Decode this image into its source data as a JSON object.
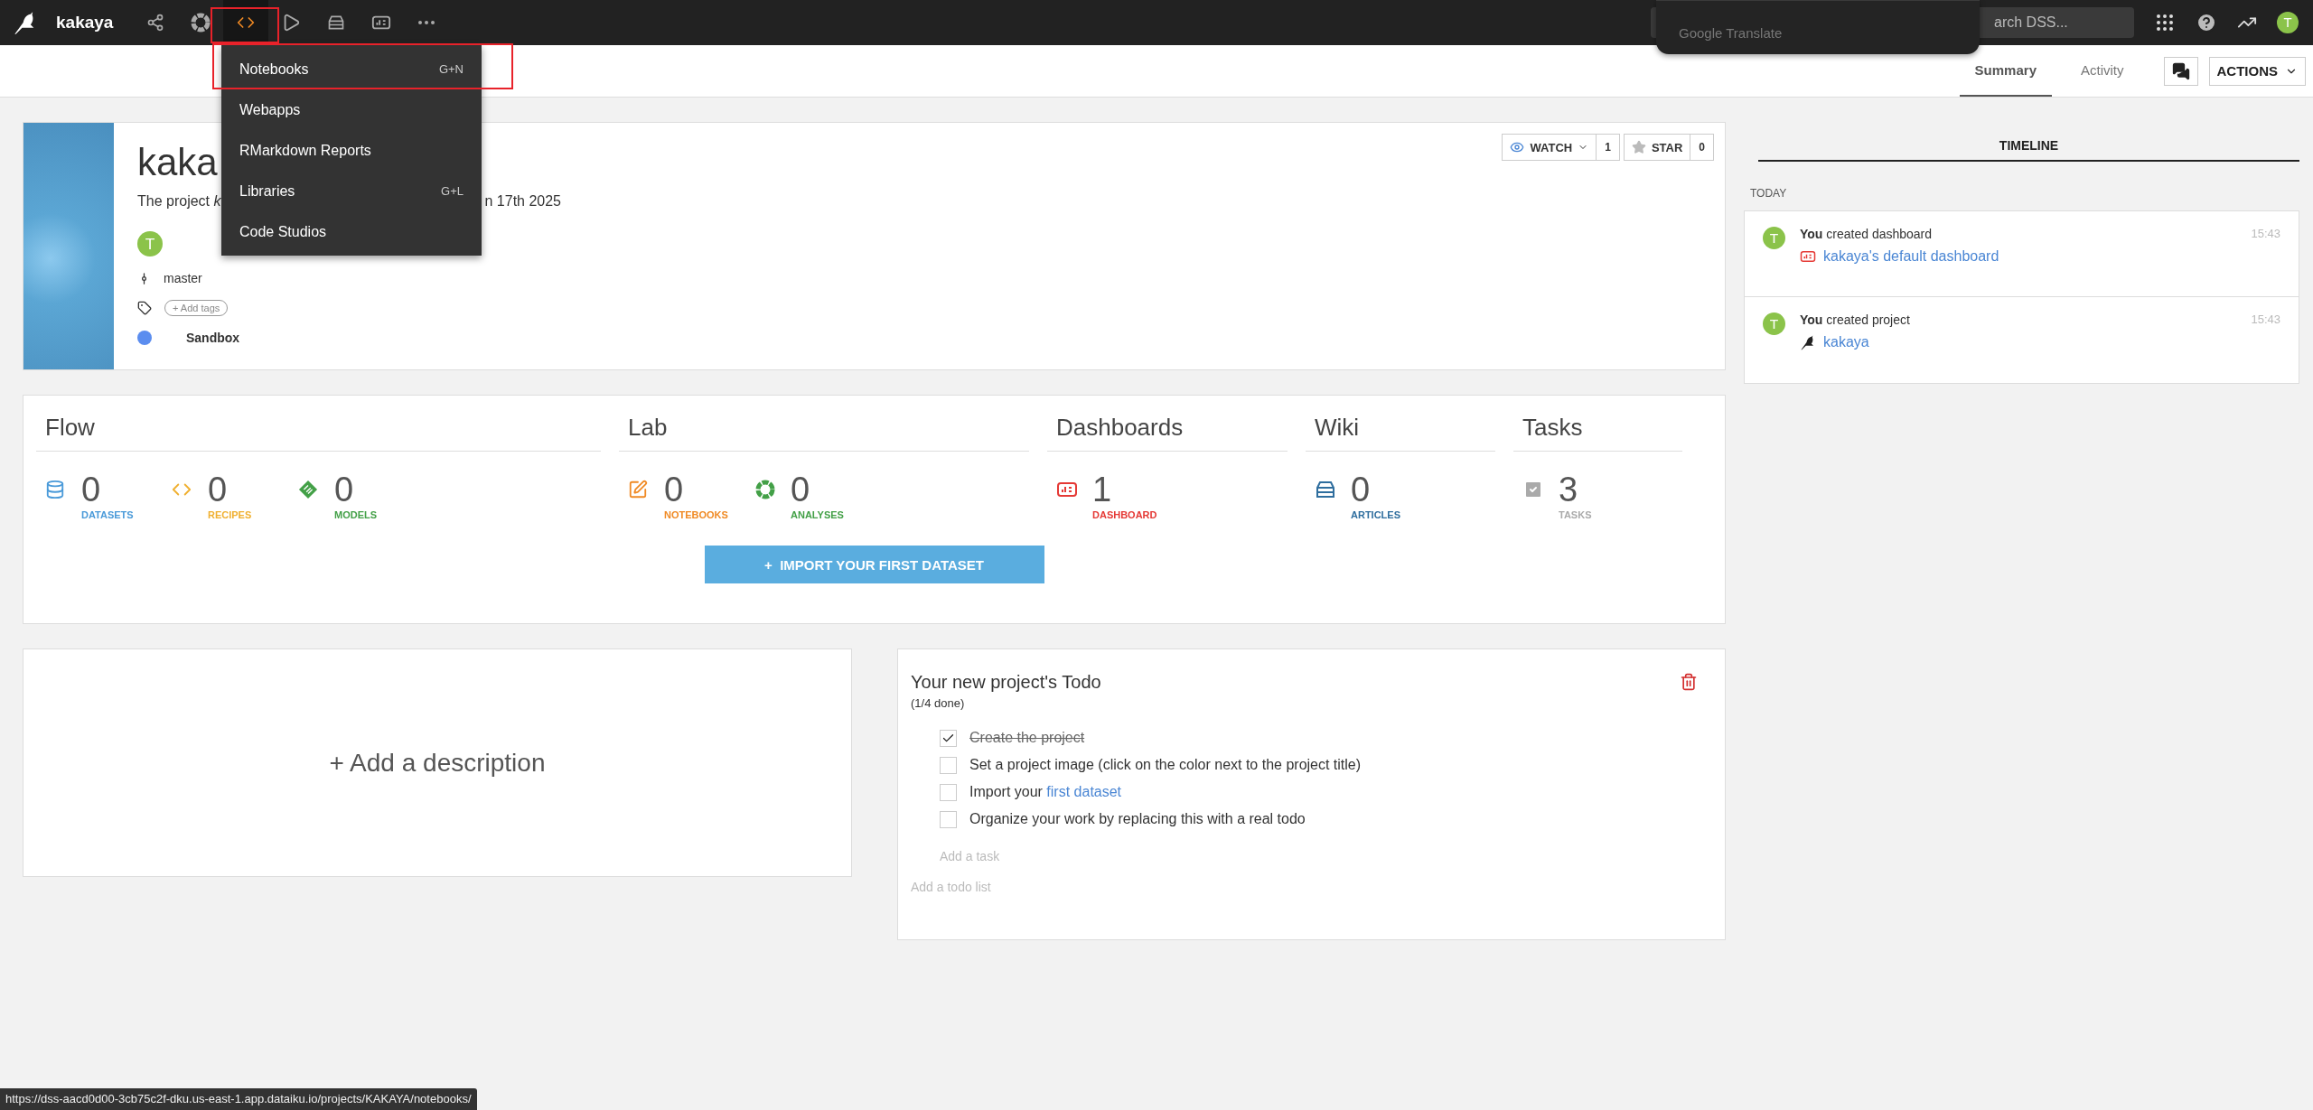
{
  "top_bar": {
    "project_name": "kakaya",
    "nav_items": [
      {
        "kind": "flow",
        "selected": false
      },
      {
        "kind": "analyses",
        "selected": false
      },
      {
        "kind": "code",
        "selected": true
      },
      {
        "kind": "run",
        "selected": false
      },
      {
        "kind": "wiki",
        "selected": false
      },
      {
        "kind": "dashboard",
        "selected": false
      },
      {
        "kind": "more",
        "selected": false
      }
    ],
    "search": {
      "placeholder": "arch DSS..."
    },
    "user_avatar": "T"
  },
  "translate_popup": {
    "label": "Google Translate"
  },
  "code_menu": {
    "items": [
      {
        "label": "Notebooks",
        "shortcut": "G+N"
      },
      {
        "label": "Webapps"
      },
      {
        "label": "RMarkdown Reports"
      },
      {
        "label": "Libraries",
        "shortcut": "G+L"
      },
      {
        "label": "Code Studios"
      }
    ]
  },
  "sub_bar": {
    "tabs": [
      {
        "label": "Summary",
        "selected": true
      },
      {
        "label": "Activity",
        "selected": false
      }
    ],
    "actions_button": "ACTIONS"
  },
  "project": {
    "title": "kaka",
    "description_start": "The project *k*",
    "description_end": "n 17th 2025",
    "owner_initial": "T",
    "branch": "master",
    "add_tags": "+ Add tags",
    "status": {
      "label": "Sandbox",
      "color": "#5b8def"
    },
    "watch": {
      "label": "WATCH",
      "count": "1"
    },
    "star": {
      "label": "STAR",
      "count": "0"
    }
  },
  "sections": [
    {
      "title": "Flow",
      "stats": [
        {
          "kind": "datasets",
          "value": "0",
          "label": "DATASETS",
          "color": "#4a9ad9"
        },
        {
          "kind": "recipes",
          "value": "0",
          "label": "RECIPES",
          "color": "#f0b030"
        },
        {
          "kind": "models",
          "value": "0",
          "label": "MODELS",
          "color": "#43a047"
        }
      ]
    },
    {
      "title": "Lab",
      "stats": [
        {
          "kind": "notebooks",
          "value": "0",
          "label": "NOTEBOOKS",
          "color": "#f08a24"
        },
        {
          "kind": "analyses",
          "value": "0",
          "label": "ANALYSES",
          "color": "#43a047"
        }
      ]
    },
    {
      "title": "Dashboards",
      "stats": [
        {
          "kind": "dashboard",
          "value": "1",
          "label": "DASHBOARD",
          "color": "#e53935"
        }
      ]
    },
    {
      "title": "Wiki",
      "stats": [
        {
          "kind": "articles",
          "value": "0",
          "label": "ARTICLES",
          "color": "#2f6e9e"
        }
      ]
    },
    {
      "title": "Tasks",
      "stats": [
        {
          "kind": "tasks",
          "value": "3",
          "label": "TASKS",
          "color": "#aaaaaa"
        }
      ]
    }
  ],
  "import_button": "+  IMPORT YOUR FIRST DATASET",
  "description_placeholder": "+ Add a description",
  "todo": {
    "title": "Your new project's Todo",
    "progress": "(1/4 done)",
    "items": [
      {
        "text": "Create the project",
        "checked": true
      },
      {
        "text": "Set a project image (click on the color next to the project title)",
        "checked": false
      },
      {
        "text": "Import your ",
        "link": "first dataset",
        "checked": false
      },
      {
        "text": "Organize your work by replacing this with a real todo",
        "checked": false
      }
    ],
    "add_task": "Add a task",
    "add_list": "Add a todo list"
  },
  "timeline": {
    "title": "TIMELINE",
    "group": "TODAY",
    "events": [
      {
        "avatar": "T",
        "actor": "You",
        "action": " created dashboard",
        "time": "15:43",
        "kind": "dashboard",
        "target": "kakaya's default dashboard"
      },
      {
        "avatar": "T",
        "actor": "You",
        "action": " created project",
        "time": "15:43",
        "kind": "project",
        "target": "kakaya"
      }
    ]
  },
  "status_url": "https://dss-aacd0d00-3cb75c2f-dku.us-east-1.app.dataiku.io/projects/KAKAYA/notebooks/"
}
